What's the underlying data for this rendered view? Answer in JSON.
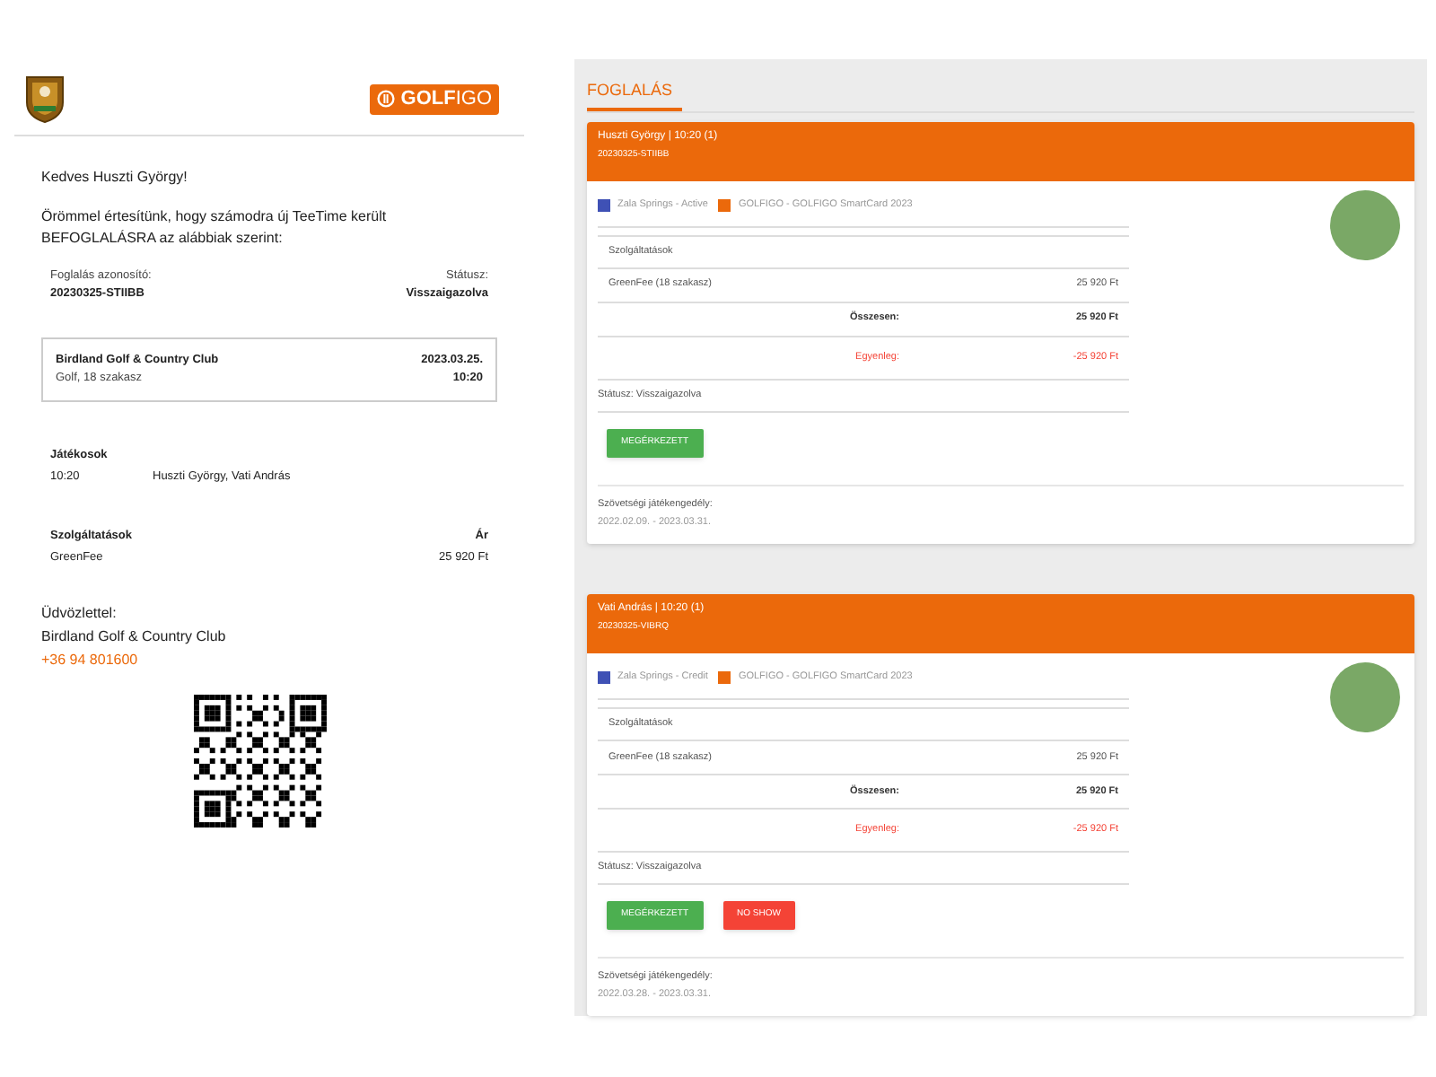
{
  "email": {
    "logo": {
      "bold": "GOLF",
      "light": "IGO"
    },
    "greeting": "Kedves Huszti György!",
    "intro": "Örömmel értesítünk, hogy számodra új TeeTime került BEFOGLALÁSRA az alábbiak szerint:",
    "booking_id": {
      "label": "Foglalás azonosító:",
      "value": "20230325-STIIBB"
    },
    "status": {
      "label": "Státusz:",
      "value": "Visszaigazolva"
    },
    "club": {
      "name": "Birdland Golf & Country Club",
      "detail": "Golf, 18 szakasz",
      "date": "2023.03.25.",
      "time": "10:20"
    },
    "players": {
      "title": "Játékosok",
      "time": "10:20",
      "names": "Huszti György, Vati András"
    },
    "services": {
      "title": "Szolgáltatások",
      "price_title": "Ár",
      "item": "GreenFee",
      "price": "25 920 Ft"
    },
    "signoff": [
      "Üdvözlettel:",
      "Birdland Golf & Country Club"
    ],
    "phone": "+36 94 801600"
  },
  "panel": {
    "title": "FOGLALÁS",
    "cards": [
      {
        "header": "Huszti György | 10:20 (1)",
        "code": "20230325-STIIBB",
        "legend": [
          {
            "label": "Zala Springs - Active",
            "color": "#3f51b5"
          },
          {
            "label": "GOLFIGO - GOLFIGO SmartCard 2023",
            "color": "#eb690b"
          }
        ],
        "services_title": "Szolgáltatások",
        "item": "GreenFee (18 szakasz)",
        "item_price": "25 920 Ft",
        "total_label": "Összesen:",
        "total": "25 920 Ft",
        "balance_label": "Egyenleg:",
        "balance": "-25 920 Ft",
        "status": "Státusz: Visszaigazolva",
        "buttons": [
          {
            "label": "MEGÉRKEZETT",
            "kind": "arrived"
          }
        ],
        "license_label": "Szövetségi játékengedély:",
        "license_dates": "2022.02.09. - 2023.03.31."
      },
      {
        "header": "Vati András | 10:20 (1)",
        "code": "20230325-VIBRQ",
        "legend": [
          {
            "label": "Zala Springs - Credit",
            "color": "#3f51b5"
          },
          {
            "label": "GOLFIGO - GOLFIGO SmartCard 2023",
            "color": "#eb690b"
          }
        ],
        "services_title": "Szolgáltatások",
        "item": "GreenFee (18 szakasz)",
        "item_price": "25 920 Ft",
        "total_label": "Összesen:",
        "total": "25 920 Ft",
        "balance_label": "Egyenleg:",
        "balance": "-25 920 Ft",
        "status": "Státusz: Visszaigazolva",
        "buttons": [
          {
            "label": "MEGÉRKEZETT",
            "kind": "arrived"
          },
          {
            "label": "NO SHOW",
            "kind": "no_show"
          }
        ],
        "license_label": "Szövetségi játékengedély:",
        "license_dates": "2022.03.28. - 2023.03.31."
      }
    ]
  }
}
